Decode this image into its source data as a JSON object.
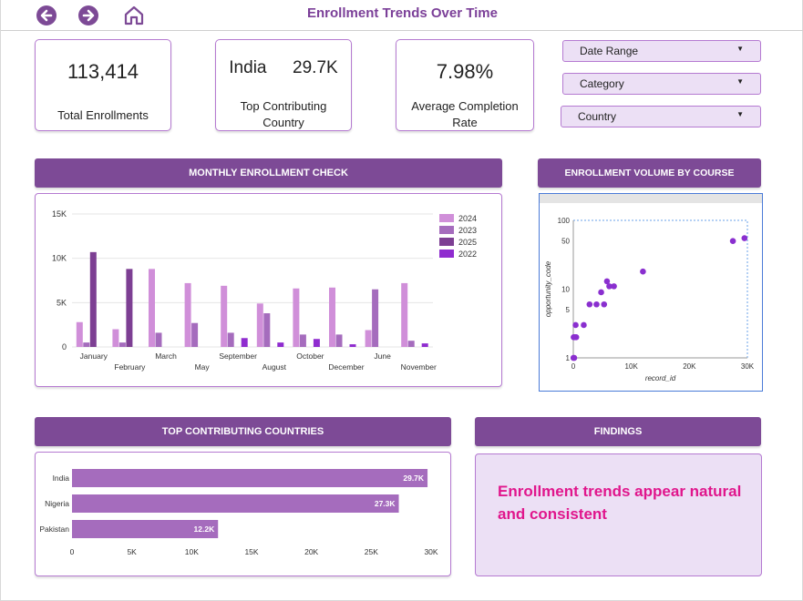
{
  "header": {
    "title": "Enrollment Trends Over Time",
    "back_icon": "arrow-left-icon",
    "forward_icon": "arrow-right-icon",
    "home_icon": "home-icon"
  },
  "kpis": {
    "total": {
      "value": "113,414",
      "label": "Total Enrollments"
    },
    "country": {
      "name": "India",
      "value": "29.7K",
      "label_line1": "Top Contributing",
      "label_line2": "Country"
    },
    "completion": {
      "value": "7.98%",
      "label_line1": "Average Completion",
      "label_line2": "Rate"
    }
  },
  "slicers": [
    {
      "label": "Date Range"
    },
    {
      "label": "Category"
    },
    {
      "label": "Country"
    }
  ],
  "sections": {
    "monthly": "MONTHLY ENROLLMENT CHECK",
    "volume": "ENROLLMENT VOLUME BY COURSE CATEGORY",
    "countries": "TOP CONTRIBUTING COUNTRIES",
    "findings": "FINDINGS"
  },
  "findings_text": "Enrollment trends appear natural and consistent",
  "colors": {
    "accent": "#7d4a96",
    "border": "#b57ad1",
    "panel_fill": "#ece0f5",
    "findings_text": "#e0168c",
    "s2024": "#d08fd9",
    "s2023": "#a56cbd",
    "s2025": "#7d3f93",
    "s2022": "#8f2ccf",
    "bar": "#a56cbd",
    "scatter": "#8a2fcf"
  },
  "chart_data": [
    {
      "type": "bar",
      "categories": [
        "January",
        "February",
        "March",
        "May",
        "September",
        "August",
        "October",
        "December",
        "June",
        "November"
      ],
      "series": [
        {
          "name": "2024",
          "values": [
            2800,
            2000,
            8800,
            7200,
            6900,
            4900,
            6600,
            6700,
            1900,
            7200
          ]
        },
        {
          "name": "2023",
          "values": [
            500,
            500,
            1600,
            2700,
            1600,
            3800,
            1400,
            1400,
            6500,
            700
          ]
        },
        {
          "name": "2025",
          "values": [
            10700,
            8800,
            0,
            0,
            0,
            0,
            0,
            0,
            0,
            0
          ]
        },
        {
          "name": "2022",
          "values": [
            0,
            0,
            0,
            0,
            1000,
            500,
            900,
            300,
            0,
            400
          ]
        }
      ],
      "yticks": [
        "0",
        "5K",
        "10K",
        "15K"
      ],
      "ylim": [
        0,
        15000
      ],
      "legend": "top-right",
      "grid": true
    },
    {
      "type": "scatter",
      "xlabel": "record_id",
      "ylabel": "opportunity_code",
      "xticks": [
        "0",
        "10K",
        "20K",
        "30K"
      ],
      "yticks": [
        "1",
        "5",
        "10",
        "50",
        "100"
      ],
      "xlim": [
        0,
        30000
      ],
      "ylim": [
        1,
        100
      ],
      "y_scale": "log",
      "points": [
        [
          30,
          1
        ],
        [
          150,
          1
        ],
        [
          60,
          2
        ],
        [
          300,
          2
        ],
        [
          400,
          3
        ],
        [
          500,
          2
        ],
        [
          1800,
          3
        ],
        [
          2800,
          6
        ],
        [
          4000,
          6
        ],
        [
          4800,
          9
        ],
        [
          5300,
          6
        ],
        [
          5800,
          13
        ],
        [
          6200,
          11
        ],
        [
          7000,
          11
        ],
        [
          12000,
          18
        ],
        [
          27500,
          50
        ],
        [
          29500,
          55
        ]
      ]
    },
    {
      "type": "bar",
      "orientation": "horizontal",
      "categories": [
        "India",
        "Nigeria",
        "Pakistan"
      ],
      "values": [
        29700,
        27300,
        12200
      ],
      "data_labels": [
        "29.7K",
        "27.3K",
        "12.2K"
      ],
      "xticks": [
        "0",
        "5K",
        "10K",
        "15K",
        "20K",
        "25K",
        "30K"
      ],
      "xlim": [
        0,
        30000
      ]
    }
  ]
}
